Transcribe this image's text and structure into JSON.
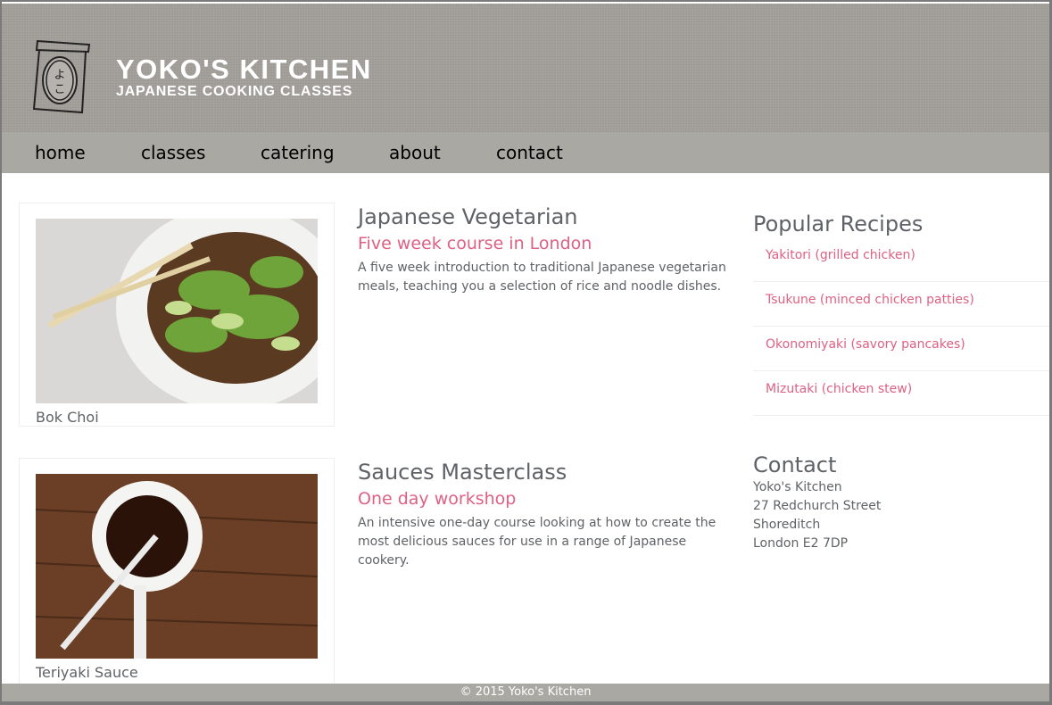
{
  "header": {
    "title": "YOKO'S KITCHEN",
    "subtitle": "JAPANESE COOKING CLASSES",
    "logo_text": "よこ"
  },
  "nav": [
    "home",
    "classes",
    "catering",
    "about",
    "contact"
  ],
  "courses": [
    {
      "title": "Japanese Vegetarian",
      "subtitle": "Five week course in London",
      "description": "A five week introduction to traditional Japanese vegetarian meals, teaching you a selection of rice and noodle dishes.",
      "caption": "Bok Choi"
    },
    {
      "title": "Sauces Masterclass",
      "subtitle": "One day workshop",
      "description": "An intensive one-day course looking at how to create the most delicious sauces for use in a range of Japanese cookery.",
      "caption": "Teriyaki Sauce"
    }
  ],
  "recipes": {
    "heading": "Popular Recipes",
    "items": [
      "Yakitori (grilled chicken)",
      "Tsukune (minced chicken patties)",
      "Okonomiyaki (savory pancakes)",
      "Mizutaki (chicken stew)"
    ]
  },
  "contact": {
    "heading": "Contact",
    "lines": [
      "Yoko's Kitchen",
      "27 Redchurch Street",
      "Shoreditch",
      "London E2 7DP"
    ]
  },
  "footer": "© 2015 Yoko's Kitchen"
}
